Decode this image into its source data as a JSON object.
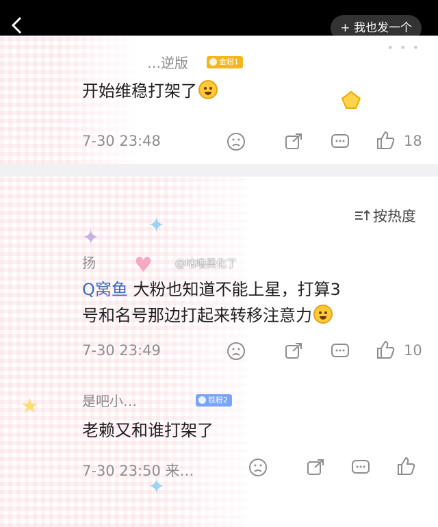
{
  "header": {
    "post_label": "+ 我也发一个",
    "more": "• • •"
  },
  "comment1": {
    "username": "…逆版",
    "badge": "金粉1",
    "text": "开始维稳打架了",
    "time": "7-30 23:48",
    "likes": "18"
  },
  "comment2": {
    "sort_label": "按热度",
    "username": "扬",
    "watermark": "@咕噜黑化了",
    "mention": "Q窝鱼",
    "text_line1": "大粉也知道不能上星，打算3",
    "text_line2": "号和名号那边打起来转移注意力",
    "time": "7-30 23:49",
    "likes": "10"
  },
  "comment3": {
    "username": "是吧小…",
    "badge": "铁粉2",
    "text": "老赖又和谁打架了",
    "time": "7-30 23:50  来…"
  },
  "colors": {
    "accent": "#3b6dbf",
    "gold_badge": "#f3b61f",
    "blue_badge": "#7aa5f7"
  }
}
